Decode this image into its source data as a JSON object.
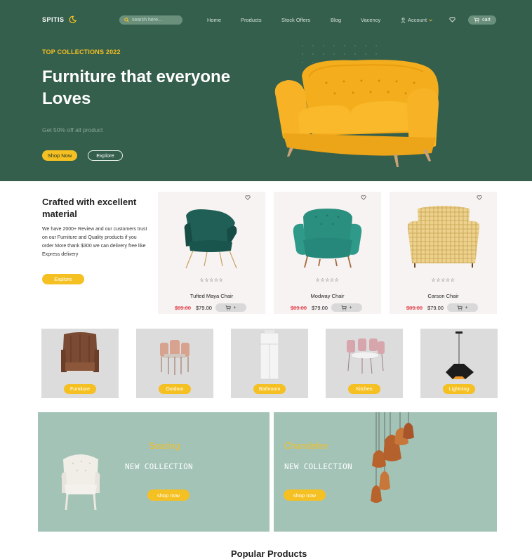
{
  "nav": {
    "logo": "SPITIS",
    "search_placeholder": "search here...",
    "links": [
      "Home",
      "Products",
      "Stock Offers",
      "Blog",
      "Vacency"
    ],
    "account": "Account",
    "cart": "cart"
  },
  "hero": {
    "kicker": "TOP COLLECTIONS 2022",
    "title": "Furniture that everyone Loves",
    "subtitle": "Get 50% off all product",
    "shop_now": "Shop Now",
    "explore": "Explore",
    "product_color": "#f5b623"
  },
  "crafted": {
    "title": "Crafted with excellent material",
    "text": "We have 2000+ Review and our customers trust on our Furniture and Quality products if you order More thank $300 we can delivery free like Express delivery",
    "button": "Explore"
  },
  "products": [
    {
      "name": "Tufted Maya Chair",
      "old_price": "$89.00",
      "price": "$79.00",
      "stars": "☆☆☆☆☆",
      "color": "#1f5f56"
    },
    {
      "name": "Modway Chair",
      "old_price": "$89.00",
      "price": "$79.00",
      "stars": "☆☆☆☆☆",
      "color": "#2a8f7f"
    },
    {
      "name": "Carson Chair",
      "old_price": "$89.00",
      "price": "$79.00",
      "stars": "☆☆☆☆☆",
      "color": "#e8c978"
    }
  ],
  "cart_add_label": "+",
  "categories": [
    {
      "label": "Furniture"
    },
    {
      "label": "Outdoor"
    },
    {
      "label": "Bathroom"
    },
    {
      "label": "Kitchen"
    },
    {
      "label": "Lightning"
    }
  ],
  "banners": [
    {
      "title": "Seating",
      "subtitle": "NEW COLLECTION",
      "button": "shop now"
    },
    {
      "title": "Chandelier",
      "subtitle": "NEW COLLECTION",
      "button": "shop now"
    }
  ],
  "popular_title": "Popular Products",
  "colors": {
    "brand_green": "#355f4d",
    "accent_yellow": "#f5c022",
    "banner_green": "#a3c3b7"
  }
}
